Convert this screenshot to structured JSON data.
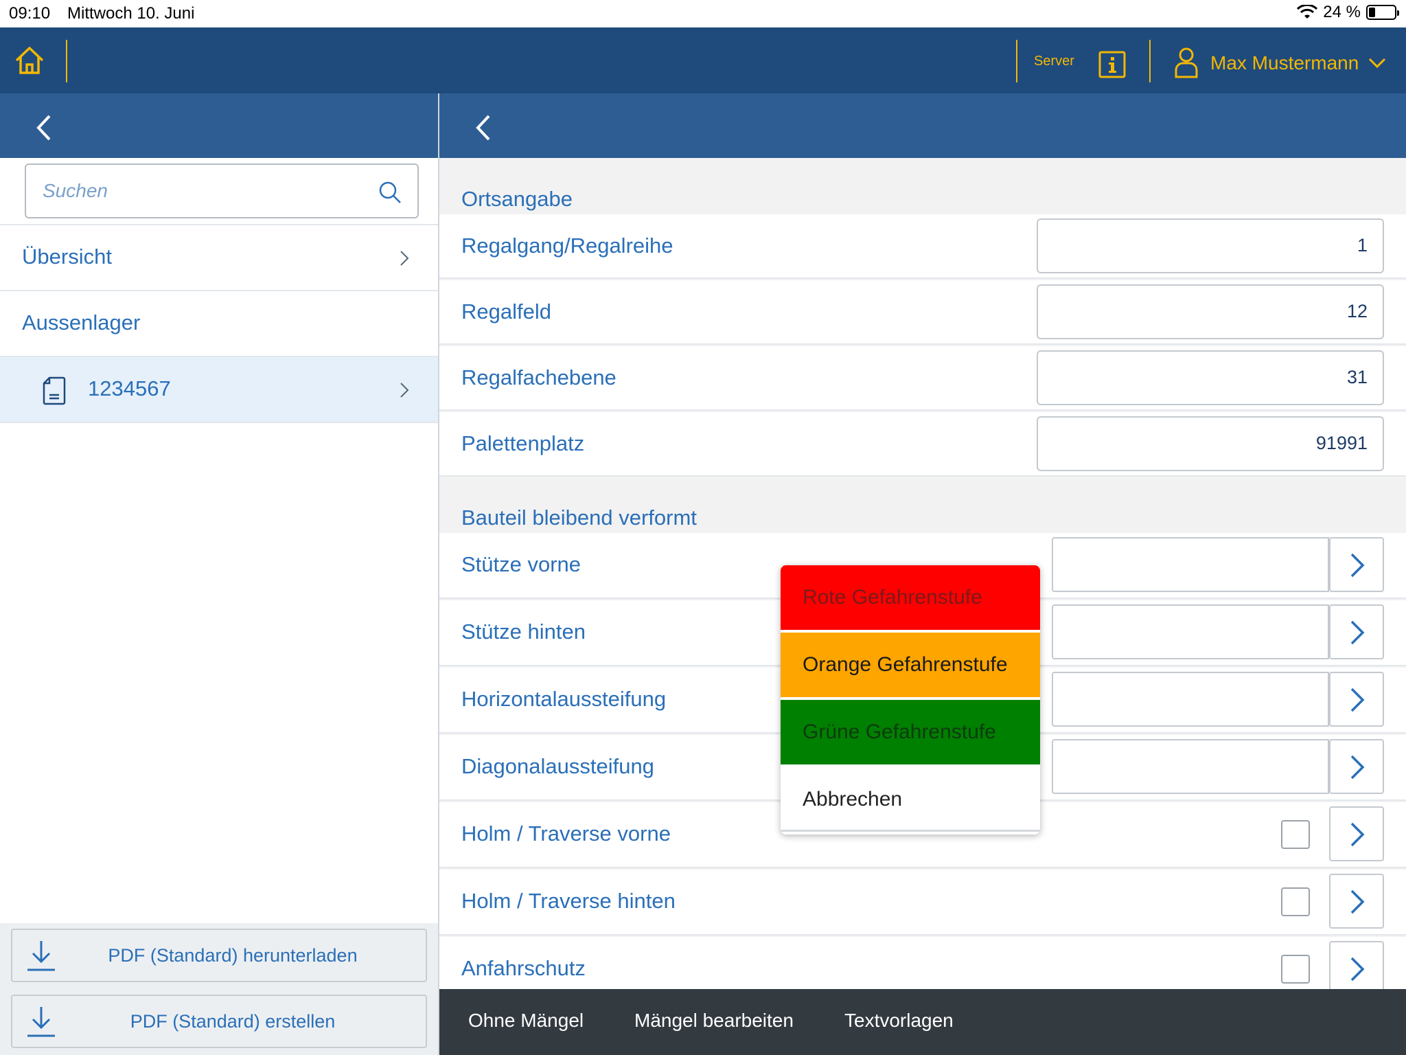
{
  "status_bar": {
    "time": "09:10",
    "date": "Mittwoch 10. Juni",
    "battery": "24 %",
    "battery_level": 0.24
  },
  "header": {
    "server_label": "Server",
    "user_name": "Max Mustermann"
  },
  "colors": {
    "header_bg": "#1f4a7c",
    "subheader_bg": "#2e5d93",
    "accent": "#f3b800",
    "link": "#2a6fb8",
    "red": "#ff0000",
    "orange": "#ffa500",
    "green": "#008000"
  },
  "sidebar": {
    "search": {
      "placeholder": "Suchen",
      "value": ""
    },
    "items": [
      {
        "label": "Übersicht"
      },
      {
        "label": "Aussenlager"
      },
      {
        "label": "1234567"
      }
    ],
    "buttons": [
      {
        "label": "PDF (Standard) herunterladen"
      },
      {
        "label": "PDF (Standard) erstellen"
      }
    ]
  },
  "main": {
    "section1": {
      "title": "Ortsangabe",
      "rows": [
        {
          "label": "Regalgang/Regalreihe",
          "value": "1"
        },
        {
          "label": "Regalfeld",
          "value": "12"
        },
        {
          "label": "Regalfachebene",
          "value": "31"
        },
        {
          "label": "Palettenplatz",
          "value": "91991"
        }
      ]
    },
    "section2": {
      "title": "Bauteil bleibend verformt",
      "rows": [
        {
          "label": "Stütze vorne"
        },
        {
          "label": "Stütze hinten"
        },
        {
          "label": "Horizontalaussteifung"
        },
        {
          "label": "Diagonalaussteifung"
        },
        {
          "label": "Holm / Traverse vorne"
        },
        {
          "label": "Holm / Traverse hinten"
        },
        {
          "label": "Anfahrschutz"
        }
      ]
    }
  },
  "popover": {
    "options": [
      {
        "label": "Rote Gefahrenstufe"
      },
      {
        "label": "Orange Gefahrenstufe"
      },
      {
        "label": "Grüne Gefahrenstufe"
      },
      {
        "label": "Abbrechen"
      }
    ]
  },
  "toolbar": {
    "items": [
      {
        "label": "Ohne Mängel"
      },
      {
        "label": "Mängel bearbeiten"
      },
      {
        "label": "Textvorlagen"
      }
    ]
  }
}
